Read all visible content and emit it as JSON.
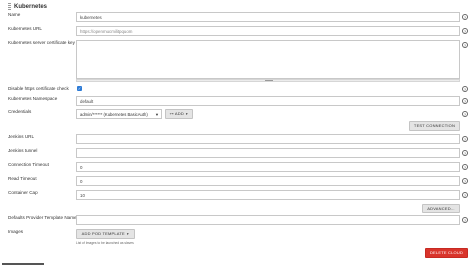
{
  "section": {
    "title": "Kubernetes"
  },
  "fields": {
    "name": {
      "label": "Name",
      "value": "kubernetes"
    },
    "url": {
      "label": "Kubernetes URL",
      "value": "https://openmucmilitpquom"
    },
    "cert_key": {
      "label": "Kubernetes server certificate key"
    },
    "disable_https": {
      "label": "Disable https certificate check",
      "checked": true
    },
    "namespace": {
      "label": "Kubernetes Namespace",
      "value": "default"
    },
    "credentials": {
      "label": "Credentials",
      "selected": "admin/****** (Kubernetes BasicAuth)"
    },
    "jenkins_url": {
      "label": "Jenkins URL",
      "value": ""
    },
    "jenkins_tunnel": {
      "label": "Jenkins tunnel",
      "value": ""
    },
    "connection_timeout": {
      "label": "Connection Timeout",
      "value": "0"
    },
    "read_timeout": {
      "label": "Read Timeout",
      "value": "0"
    },
    "container_cap": {
      "label": "Container Cap",
      "value": "10"
    },
    "defaults_provider": {
      "label": "Defaults Provider Template Name",
      "value": ""
    },
    "images": {
      "label": "Images",
      "hint": "List of Images to be launched as slaves"
    }
  },
  "buttons": {
    "add_credentials": "Add",
    "test_connection": "Test Connection",
    "advanced": "Advanced...",
    "add_pod_template": "Add Pod Template",
    "delete_cloud": "Delete cloud"
  },
  "icons": {
    "help": "?",
    "check": "✓",
    "dropdown": "▼",
    "key": "⊶"
  },
  "colors": {
    "danger": "#d9342b",
    "checkbox": "#2d7bd6"
  }
}
